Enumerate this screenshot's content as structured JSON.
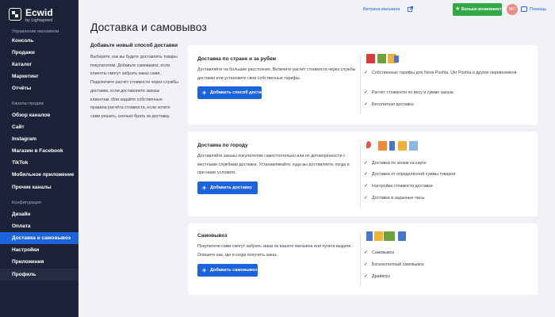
{
  "sidebar": {
    "logo_name": "Ecwid",
    "logo_sub": "by Lightspeed",
    "sections": {
      "manage": "Управление магазином",
      "channels": "Каналы продаж",
      "config": "Конфигурация"
    },
    "items": [
      "Консоль",
      "Продажи",
      "Каталог",
      "Маркетинг",
      "Отчёты",
      "Обзор каналов",
      "Сайт",
      "Instagram",
      "Магазин в Facebook",
      "TikTok",
      "Мобильное приложение",
      "Прочие каналы",
      "Дизайн",
      "Оплата",
      "Доставка и самовывоз",
      "Настройки",
      "Приложения",
      "Профиль"
    ]
  },
  "topbar": {
    "storefront": "Витрина магазина",
    "upgrade": "Больше возможностей",
    "avatar_initials": "МС",
    "help": "Помощь"
  },
  "page": {
    "title": "Доставка и самовывоз",
    "left_title": "Добавьте новый способ доставки",
    "left_desc": "Выберите, как вы будете доставлять товары покупателям. Добавьте самовывоз, если клиенты смогут забрать заказ сами. Подключите расчёт стоимости через службы доставки, если доставляете заказы клиентам. Или задайте собственные правила расчёта стоимости, если хотите сами решать, сколько брать за доставку."
  },
  "cards": [
    {
      "title": "Доставка по стране и за рубеж",
      "desc": "Доставляйте на большие расстояния. Включите расчёт стоимости через службы доставки или установите свои собственные тарифы.",
      "button": "Добавить способ доставки",
      "features": [
        "Собственные тарифы для Nova Poshta, Ukr Poshta и других перевозчиков",
        "Расчёт стоимости по весу и сумме заказа",
        "Бесплатная доставка"
      ]
    },
    {
      "title": "Доставка по городу",
      "desc": "Доставляйте заказы покупателям самостоятельно или по договорённости с местными службами доставки. Устанавливайте, куда вы доставляете, когда и при каких условиях.",
      "button": "Добавить доставку",
      "features": [
        "Доставка по зонам на карте",
        "Доставка от определённой суммы товаров",
        "Настройка стоимости доставки",
        "Доставка в заданные часы"
      ]
    },
    {
      "title": "Самовывоз",
      "desc": "Покупатели сами смогут забрать заказ из вашего магазина или пункта выдачи. Опишите как, где и когда получить заказ.",
      "button": "Добавить самовывоз",
      "features": [
        "Самовывоз",
        "Бесконтактный самовывоз",
        "Драйвтру"
      ]
    }
  ],
  "colors": {
    "sidebar_bg": "#1c2339",
    "accent": "#1e63de",
    "upgrade_green": "#2fa845"
  }
}
